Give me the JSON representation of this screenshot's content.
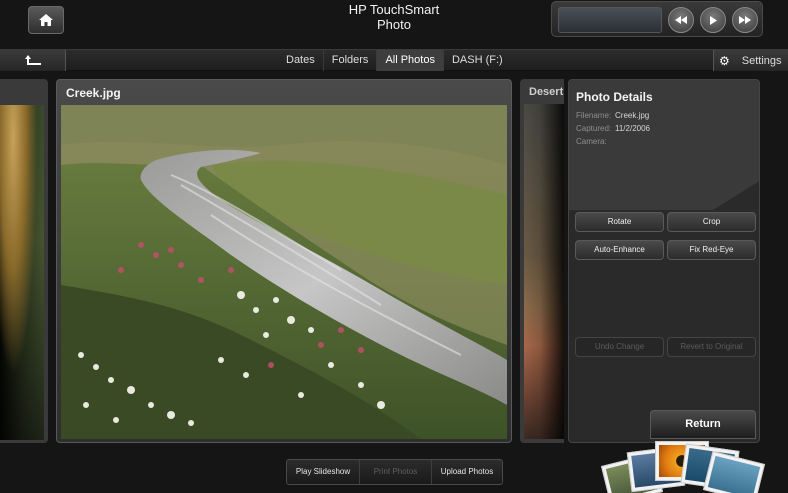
{
  "app": {
    "title_line1": "HP TouchSmart",
    "title_line2": "Photo"
  },
  "navbar": {
    "tabs": [
      {
        "label": "Dates"
      },
      {
        "label": "Folders"
      },
      {
        "label": "All Photos",
        "active": true
      },
      {
        "label": "DASH (F:)"
      }
    ],
    "settings_label": "Settings"
  },
  "media": {
    "buttons": [
      "rewind-icon",
      "play-icon",
      "fast-forward-icon"
    ]
  },
  "main_photo": {
    "title": "Creek.jpg"
  },
  "next_photo": {
    "title": "Desert"
  },
  "details": {
    "heading": "Photo Details",
    "filename_label": "Filename:",
    "filename_value": "Creek.jpg",
    "captured_label": "Captured:",
    "captured_value": "11/2/2006",
    "camera_label": "Camera:",
    "camera_value": "",
    "rotate_label": "Rotate",
    "crop_label": "Crop",
    "auto_enhance_label": "Auto-Enhance",
    "fix_red_eye_label": "Fix Red-Eye",
    "undo_label": "Undo Change",
    "revert_label": "Revert to Original",
    "return_label": "Return"
  },
  "actions": {
    "play_slideshow": "Play Slideshow",
    "print_photos": "Print Photos",
    "upload_photos": "Upload Photos"
  },
  "colors": {
    "background": "#161515",
    "panel": "#2a2a2a",
    "disabled_text": "#5c5c5c"
  }
}
